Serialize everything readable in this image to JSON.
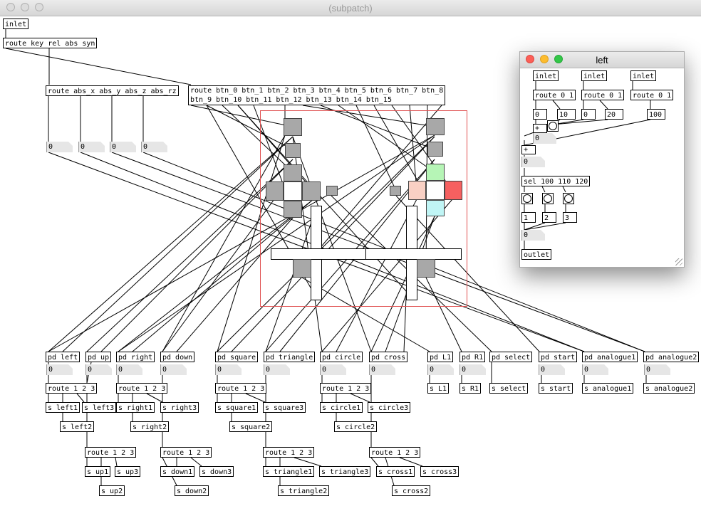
{
  "main_window": {
    "title": "(subpatch)",
    "inlet": "inlet",
    "route_keys": "route key rel abs syn",
    "route_abs": "route abs_x abs_y abs_z abs_rz",
    "route_btn_line1": "route btn_0 btn_1 btn_2 btn_3 btn_4 btn_5 btn_6 btn_7 btn_8",
    "route_btn_line2": "btn_9 btn_10 btn_11 btn_12 btn_13 btn_14 btn_15",
    "axis_numbers": [
      "0",
      "0",
      "0",
      "0"
    ]
  },
  "pd_objects": {
    "left": "pd left",
    "up": "pd up",
    "right": "pd right",
    "down": "pd down",
    "square": "pd square",
    "triangle": "pd triangle",
    "circle": "pd circle",
    "cross": "pd cross",
    "l1": "pd L1",
    "r1": "pd R1",
    "select": "pd select",
    "start": "pd start",
    "analogue1": "pd analogue1",
    "analogue2": "pd analogue2"
  },
  "number_value": "0",
  "route123": "route 1 2 3",
  "send_objects": {
    "left1": "s left1",
    "left2": "s left2",
    "left3": "s left3",
    "right1": "s right1",
    "right2": "s right2",
    "right3": "s right3",
    "square1": "s square1",
    "square2": "s square2",
    "square3": "s square3",
    "circle1": "s circle1",
    "circle2": "s circle2",
    "circle3": "s circle3",
    "l1": "s L1",
    "r1": "s R1",
    "select": "s select",
    "start": "s start",
    "analogue1": "s analogue1",
    "analogue2": "s analogue2",
    "up1": "s up1",
    "up2": "s up2",
    "up3": "s up3",
    "down1": "s down1",
    "down2": "s down2",
    "down3": "s down3",
    "triangle1": "s triangle1",
    "triangle2": "s triangle2",
    "triangle3": "s triangle3",
    "cross1": "s cross1",
    "cross2": "s cross2",
    "cross3": "s cross3"
  },
  "left_window": {
    "title": "left",
    "inlets": [
      "inlet",
      "inlet",
      "inlet"
    ],
    "routes": [
      "route 0 1",
      "route 0 1",
      "route 0 1"
    ],
    "msg_0": "0",
    "msg_10": "10",
    "msg_0b": "0",
    "msg_20": "20",
    "msg_100": "100",
    "plus1": "+",
    "plus2": "+",
    "num_a": "0",
    "num_b": "0",
    "sel": "sel 100 110 120",
    "msg_1": "1",
    "msg_2": "2",
    "msg_3": "3",
    "num_c": "0",
    "outlet": "outlet"
  },
  "colors": {
    "gui_gray": "#a8a8a8",
    "green_pad": "#b6f5b6",
    "red_pad": "#f66060",
    "pink_pad": "#f9d0c4",
    "cyan_pad": "#c0f5f5",
    "canvas_border": "#e05050"
  }
}
